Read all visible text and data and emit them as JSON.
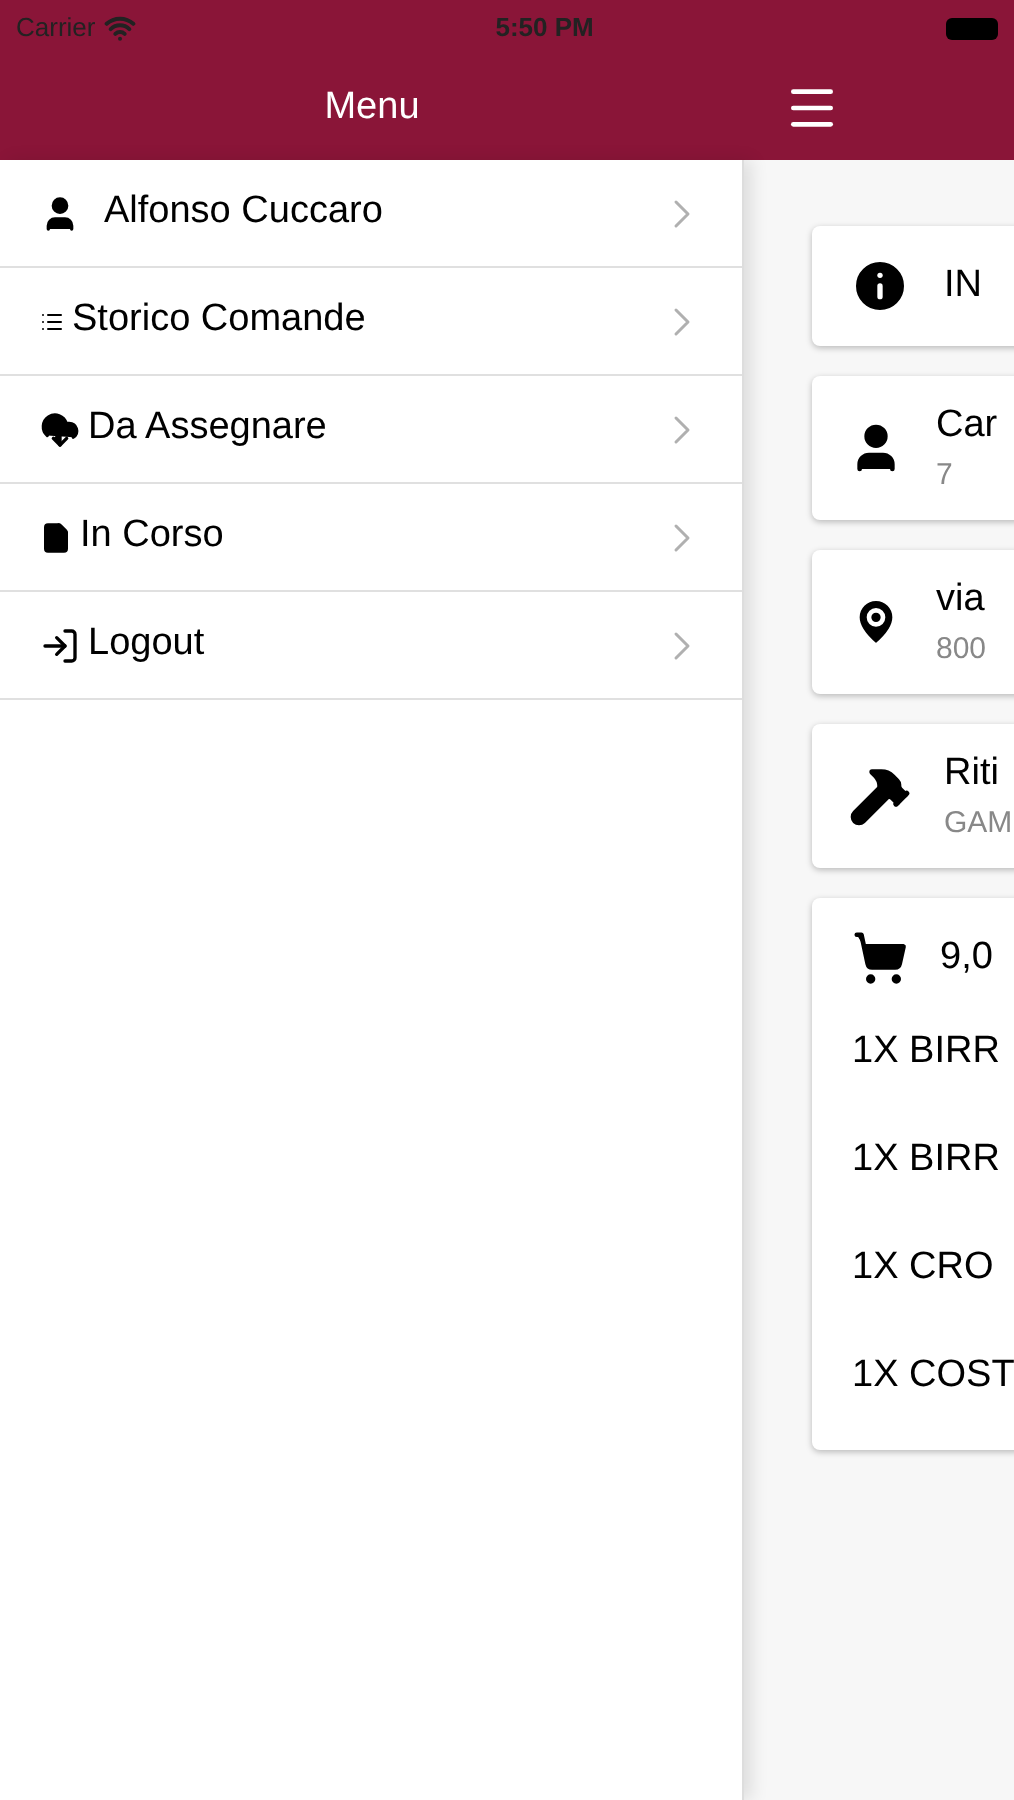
{
  "status_bar": {
    "carrier": "Carrier",
    "time": "5:50 PM"
  },
  "menu": {
    "title": "Menu",
    "items": [
      {
        "kind": "user",
        "label": "Alfonso Cuccaro"
      },
      {
        "kind": "list",
        "label": "Storico Comande"
      },
      {
        "kind": "cloud",
        "label": "Da Assegnare"
      },
      {
        "kind": "file",
        "label": "In Corso"
      },
      {
        "kind": "logout",
        "label": "Logout"
      }
    ]
  },
  "order": {
    "cards": [
      {
        "kind": "info",
        "title": "IN"
      },
      {
        "kind": "user",
        "title": "Car",
        "subtitle": "7"
      },
      {
        "kind": "pin",
        "title": "via",
        "subtitle": "800"
      },
      {
        "kind": "hammer",
        "title": "Riti",
        "subtitle": "GAM"
      }
    ],
    "total": "9,0",
    "lines": [
      "1X BIRR",
      "1X BIRR",
      "1X CRO",
      "1X COST"
    ]
  }
}
